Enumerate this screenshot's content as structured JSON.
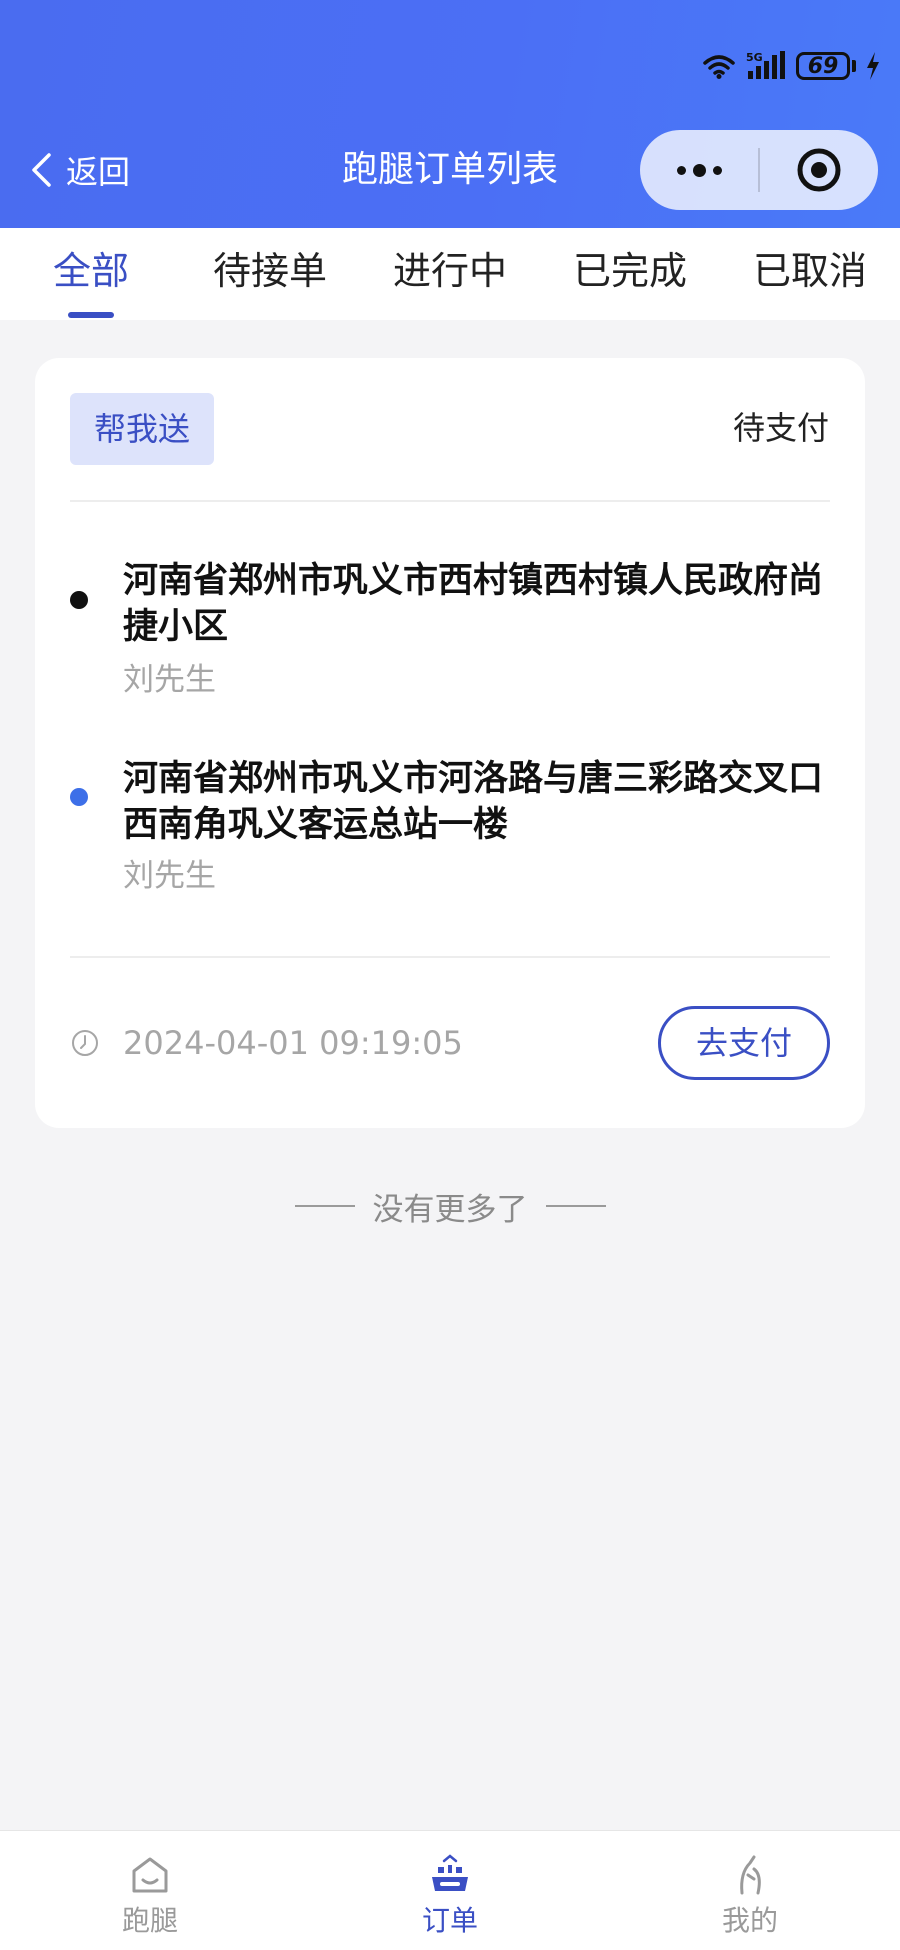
{
  "status_bar": {
    "network": "5G",
    "battery": "69"
  },
  "header": {
    "back_label": "返回",
    "title": "跑腿订单列表"
  },
  "tabs": [
    {
      "label": "全部",
      "active": true
    },
    {
      "label": "待接单",
      "active": false
    },
    {
      "label": "进行中",
      "active": false
    },
    {
      "label": "已完成",
      "active": false
    },
    {
      "label": "已取消",
      "active": false
    }
  ],
  "order": {
    "type": "帮我送",
    "status": "待支付",
    "pickup": {
      "address": "河南省郑州市巩义市西村镇西村镇人民政府尚捷小区",
      "name": "刘先生"
    },
    "dropoff": {
      "address": "河南省郑州市巩义市河洛路与唐三彩路交叉口西南角巩义客运总站一楼",
      "name": "刘先生"
    },
    "time": "2024-04-01 09:19:05",
    "pay_button": "去支付"
  },
  "no_more_text": "没有更多了",
  "tabbar": [
    {
      "label": "跑腿",
      "icon": "home-icon",
      "active": false
    },
    {
      "label": "订单",
      "icon": "order-icon",
      "active": true
    },
    {
      "label": "我的",
      "icon": "profile-icon",
      "active": false
    }
  ],
  "colors": {
    "header_blue": "#4a6cf0",
    "accent": "#3a4fc4",
    "badge_bg": "#dde3fb",
    "dropoff_dot": "#3d6fe8"
  }
}
